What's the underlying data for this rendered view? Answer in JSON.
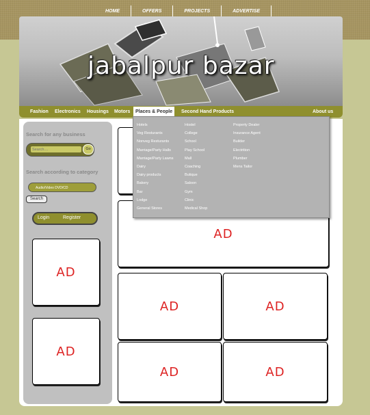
{
  "top_nav": [
    "HOME",
    "OFFERS",
    "PROJECTS",
    "ADVERTISE"
  ],
  "banner": {
    "logo_text": "jabalpur bazar"
  },
  "main_nav": {
    "items": [
      "Fashion",
      "Electronics",
      "Housings",
      "Motors",
      "Places & People",
      "Second Hand Products"
    ],
    "right_item": "About us",
    "active": "Places & People"
  },
  "dropdown": {
    "col1": [
      "Hotels",
      "Veg Resturants",
      "Nonveg Resturants",
      "Marriage/Party Halls",
      "Marriage/Party Lawns",
      "Dairy",
      "Dairy products",
      "Bakery",
      "Bar",
      "Lodge",
      "General Stores"
    ],
    "col2": [
      "Hostel",
      "College",
      "School",
      "Play School",
      "Mall",
      "Coaching",
      "Butique",
      "Saloon",
      "Gym",
      "Clinic",
      "Medical Shop"
    ],
    "col3": [
      "Property Dealer",
      "Insurance Agent",
      "Builder",
      "Electrition",
      "Plumber",
      "Mens Tailor"
    ]
  },
  "sidebar": {
    "search_title": "Search for any business",
    "search_placeholder": "Search....",
    "go_label": "Go",
    "category_title": "Search according to category",
    "category_selected": "Audio/Video DVD/CD",
    "search_button": "Search",
    "login_label": "Login",
    "register_label": "Register"
  },
  "ads": {
    "label": "AD"
  }
}
